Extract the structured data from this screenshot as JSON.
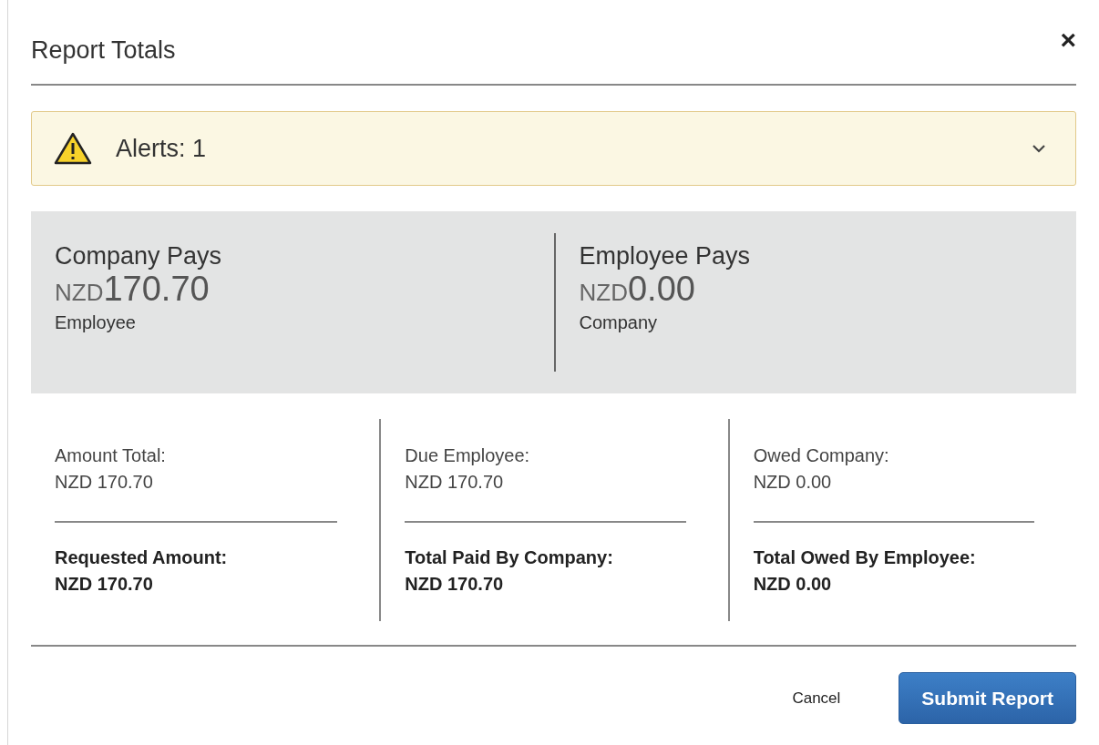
{
  "dialog": {
    "title": "Report Totals",
    "close": "×"
  },
  "alert": {
    "label": "Alerts: 1",
    "expanded": false
  },
  "summary": [
    {
      "heading": "Company Pays",
      "currency": "NZD",
      "amount": "170.70",
      "party": "Employee"
    },
    {
      "heading": "Employee Pays",
      "currency": "NZD",
      "amount": "0.00",
      "party": "Company"
    }
  ],
  "details": [
    {
      "label": "Amount Total:",
      "value": "NZD 170.70",
      "total_label": "Requested Amount:",
      "total_value": "NZD 170.70"
    },
    {
      "label": "Due Employee:",
      "value": "NZD 170.70",
      "total_label": "Total Paid By Company:",
      "total_value": "NZD 170.70"
    },
    {
      "label": "Owed Company:",
      "value": "NZD 0.00",
      "total_label": "Total Owed By Employee:",
      "total_value": "NZD 0.00"
    }
  ],
  "buttons": {
    "cancel": "Cancel",
    "submit": "Submit Report"
  }
}
